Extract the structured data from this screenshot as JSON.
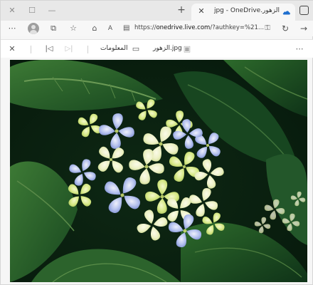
{
  "window": {
    "tab_title": "الزهور.jpg - OneDrive",
    "tab_favicon": "onedrive-cloud-icon",
    "controls": [
      "close-icon",
      "restore-icon",
      "minimize-icon"
    ]
  },
  "navbar": {
    "url_prefix": "https://",
    "url_domain": "onedrive.live.com",
    "url_rest": "/?authkey=%21...",
    "icons": [
      "more-icon",
      "profile-avatar",
      "workspaces-icon",
      "favorites-star-icon",
      "home-icon",
      "read-aloud-icon",
      "immersive-reader-icon",
      "lock-icon",
      "extensions-icon",
      "refresh-icon",
      "forward-icon"
    ]
  },
  "viewer": {
    "file_name": "الزهور.jpg",
    "info_label": "المعلومات",
    "icons": [
      "close-icon",
      "previous-icon",
      "next-icon",
      "info-icon",
      "image-file-icon",
      "more-icon"
    ]
  },
  "image": {
    "description_colors": {
      "leaf_dark": "#12391c",
      "leaf_mid": "#2f6a2e",
      "petal_blue": "#9fb2e6",
      "petal_cream": "#eef2c8",
      "petal_lime": "#d9ea8c"
    }
  }
}
